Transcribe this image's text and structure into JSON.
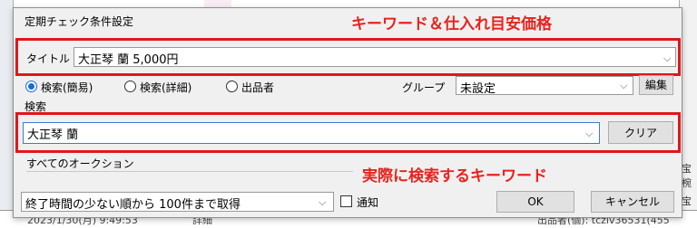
{
  "background": {
    "right_fragments": [
      "宝",
      "椀",
      "宝",
      "カ"
    ],
    "bottom_date": "2023/1/30(月) 9:49:53",
    "bottom_detail": "詳細",
    "bottom_right": "出品者(個): tczlv36531(455"
  },
  "dialog": {
    "title": "定期チェック条件設定",
    "title_row": {
      "label": "タイトル",
      "value": "大正琴 蘭  5,000円"
    },
    "search_mode": {
      "options": [
        "検索(簡易)",
        "検索(詳細)",
        "出品者"
      ],
      "selected_index": 0
    },
    "group": {
      "label": "グループ",
      "value": "未設定",
      "edit_button": "編集"
    },
    "search": {
      "label": "検索",
      "value": "大正琴 蘭",
      "clear_button": "クリア"
    },
    "auction_scope": "すべてのオークション",
    "fetch_option": "終了時間の少ない順から 100件まで取得",
    "notify_label": "通知",
    "ok_button": "OK",
    "cancel_button": "キャンセル"
  },
  "annotations": {
    "top": "キーワード＆仕入れ目安価格",
    "bottom": "実際に検索するキーワード",
    "color": "#e8231e"
  }
}
